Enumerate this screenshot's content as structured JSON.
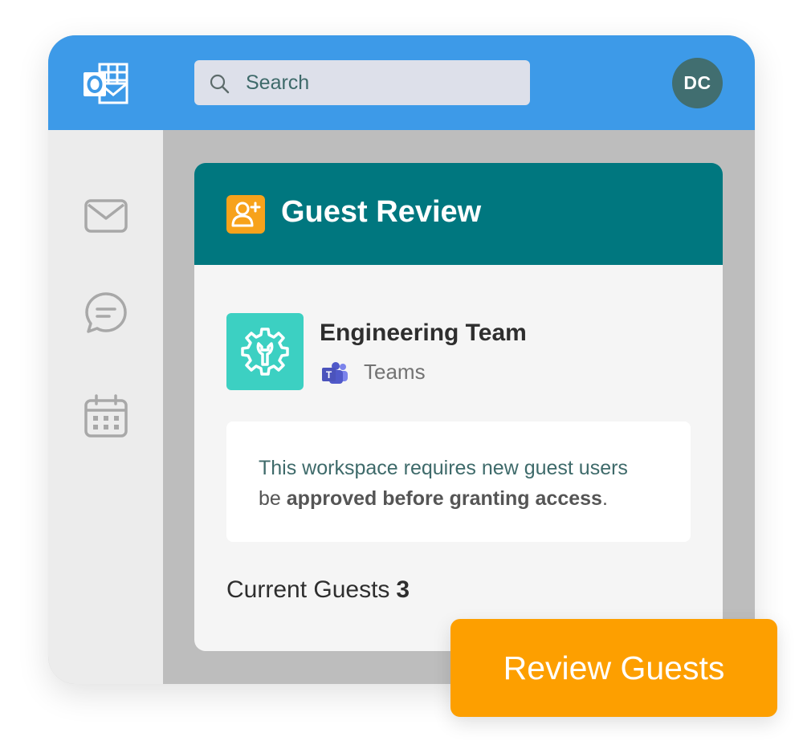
{
  "app": {
    "logo_icon": "outlook-icon",
    "brand_color": "#3d9ae8"
  },
  "search": {
    "placeholder": "Search",
    "icon": "search-icon"
  },
  "user": {
    "initials": "DC"
  },
  "sidebar": {
    "items": [
      {
        "icon": "mail-icon"
      },
      {
        "icon": "chat-icon"
      },
      {
        "icon": "calendar-icon"
      }
    ]
  },
  "card": {
    "icon": "add-user-icon",
    "title": "Guest Review",
    "header_color": "#00777f",
    "team": {
      "icon": "gear-wrench-icon",
      "name": "Engineering Team",
      "platform_icon": "teams-icon",
      "platform": "Teams"
    },
    "notice": {
      "line1": "This workspace requires new guest users",
      "line2_prefix": "be ",
      "line2_bold": "approved before granting access",
      "line2_suffix": "."
    },
    "guests": {
      "label": "Current Guests",
      "count": "3"
    }
  },
  "cta": {
    "label": "Review Guests",
    "color": "#fd9f00"
  }
}
